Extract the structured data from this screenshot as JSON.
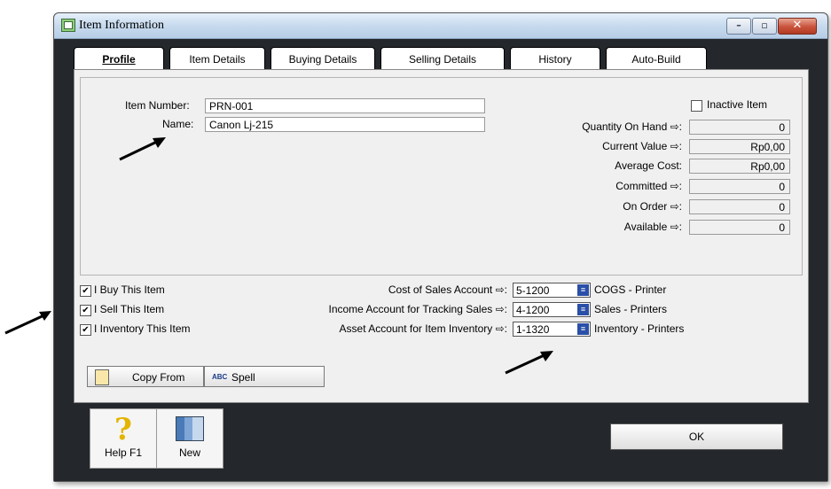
{
  "window": {
    "title": "Item Information",
    "min_glyph": "–",
    "max_glyph": "▫",
    "close_glyph": "✕"
  },
  "tabs": [
    {
      "label": "Profile"
    },
    {
      "label": "Item Details"
    },
    {
      "label": "Buying Details"
    },
    {
      "label": "Selling Details"
    },
    {
      "label": "History"
    },
    {
      "label": "Auto-Build"
    }
  ],
  "profile": {
    "item_number_label": "Item Number:",
    "item_number_value": "PRN-001",
    "name_label": "Name:",
    "name_value": "Canon Lj-215",
    "inactive_label": "Inactive Item",
    "inactive_checked": false
  },
  "stats": [
    {
      "label": "Quantity On Hand",
      "arrow": "⇨:",
      "value": "0"
    },
    {
      "label": "Current Value",
      "arrow": "⇨:",
      "value": "Rp0,00"
    },
    {
      "label": "Average Cost:",
      "arrow": "",
      "value": "Rp0,00"
    },
    {
      "label": "Committed",
      "arrow": "⇨:",
      "value": "0"
    },
    {
      "label": "On Order",
      "arrow": "⇨:",
      "value": "0"
    },
    {
      "label": "Available",
      "arrow": "⇨:",
      "value": "0"
    }
  ],
  "flags": [
    {
      "label": "I Buy This Item",
      "checked": "✔"
    },
    {
      "label": "I Sell This Item",
      "checked": "✔"
    },
    {
      "label": "I Inventory This Item",
      "checked": "✔"
    }
  ],
  "accounts": [
    {
      "label": "Cost of Sales Account",
      "arrow": "⇨:",
      "code": "5-1200",
      "name": "COGS - Printer"
    },
    {
      "label": "Income Account for Tracking Sales",
      "arrow": "⇨:",
      "code": "4-1200",
      "name": "Sales - Printers"
    },
    {
      "label": "Asset Account for Item Inventory",
      "arrow": "⇨:",
      "code": "1-1320",
      "name": "Inventory - Printers"
    }
  ],
  "actions": {
    "copy_from": "Copy From",
    "spell": "Spell",
    "spell_icon": "ABC"
  },
  "bottom": {
    "help": "Help F1",
    "new": "New",
    "ok": "OK",
    "help_glyph": "?"
  }
}
